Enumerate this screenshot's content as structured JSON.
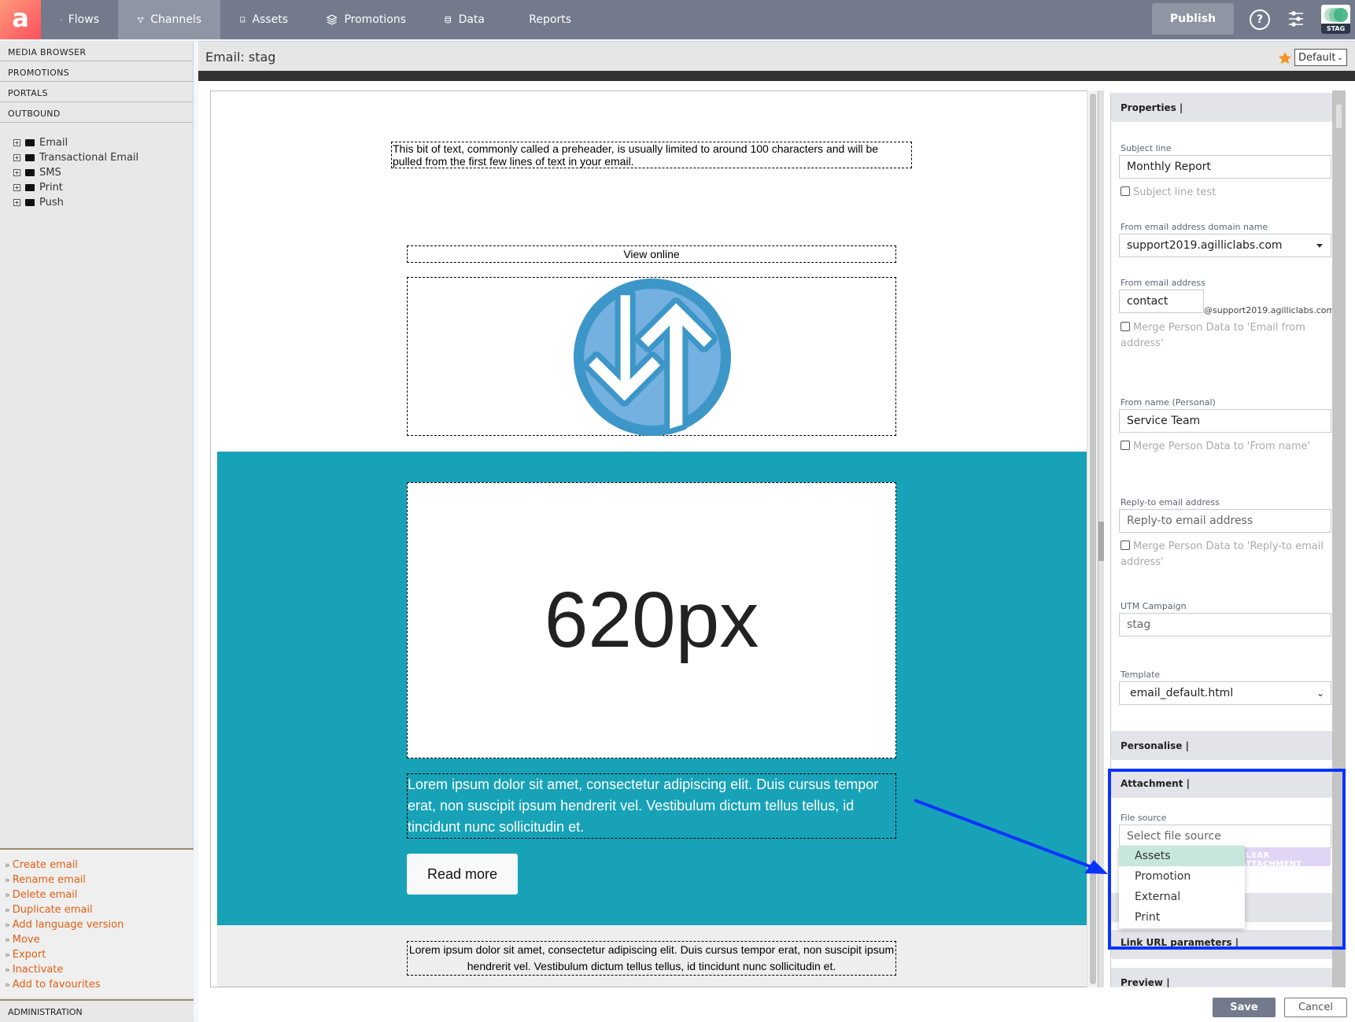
{
  "app": {
    "logo_letter": "a",
    "nav": [
      {
        "label": "Flows",
        "icon": "flows-icon",
        "active": false
      },
      {
        "label": "Channels",
        "icon": "channels-icon",
        "active": true
      },
      {
        "label": "Assets",
        "icon": "assets-icon",
        "active": false
      },
      {
        "label": "Promotions",
        "icon": "promotions-icon",
        "active": false
      },
      {
        "label": "Data",
        "icon": "data-icon",
        "active": false
      },
      {
        "label": "Reports",
        "icon": "reports-icon",
        "active": false
      }
    ],
    "publish_label": "Publish",
    "help_label": "?",
    "env_badge": "STAG"
  },
  "sidebar": {
    "sections": [
      "MEDIA BROWSER",
      "PROMOTIONS",
      "PORTALS",
      "OUTBOUND"
    ],
    "tree": [
      "Email",
      "Transactional Email",
      "SMS",
      "Print",
      "Push"
    ],
    "actions": [
      "Create email",
      "Rename email",
      "Delete email",
      "Duplicate email",
      "Add language version",
      "Move",
      "Export",
      "Inactivate",
      "Add to favourites"
    ],
    "footer_section": "ADMINISTRATION"
  },
  "editor": {
    "title": "Email: stag",
    "view_select": "Default",
    "email": {
      "preheader": "This bit of text, commonly called a preheader, is usually limited to around 100 characters and will be pulled from the first few lines of text in your email.",
      "view_online": "View online",
      "hero_placeholder": "620px",
      "hero_text": "Lorem ipsum dolor sit amet, consectetur adipiscing elit. Duis cursus tempor erat, non suscipit ipsum hendrerit vel. Vestibulum dictum tellus tellus, id tincidunt nunc sollicitudin et.",
      "read_more": "Read more",
      "footer_text": "Lorem ipsum dolor sit amet, consectetur adipiscing elit. Duis cursus tempor erat, non suscipit ipsum hendrerit vel. Vestibulum dictum tellus tellus, id tincidunt nunc sollicitudin et.",
      "colors": {
        "hero_bg": "#17a2b8",
        "logo_outer": "#3d96c8",
        "logo_inner": "#74b0e0"
      }
    }
  },
  "properties": {
    "section_title": "Properties |",
    "subject_line_label": "Subject line",
    "subject_line_value": "Monthly Report",
    "subject_line_test": "Subject line test",
    "domain_label": "From email address domain name",
    "domain_value": "support2019.agilliclabs.com",
    "from_email_label": "From email address",
    "from_email_value": "contact",
    "from_email_suffix": "@support2019.agilliclabs.com",
    "merge_from_email": "Merge Person Data to 'Email from address'",
    "from_name_label": "From name (Personal)",
    "from_name_value": "Service Team",
    "merge_from_name": "Merge Person Data to 'From name'",
    "reply_to_label": "Reply-to email address",
    "reply_to_placeholder": "Reply-to email address",
    "merge_reply_to": "Merge Person Data to 'Reply-to email address'",
    "utm_label": "UTM Campaign",
    "utm_value": "stag",
    "template_label": "Template",
    "template_value": "email_default.html",
    "personalise_title": "Personalise |",
    "attachment_title": "Attachment |",
    "file_source_label": "File source",
    "file_source_placeholder": "Select file source",
    "clear_attachment": "CLEAR ATTACHMENT",
    "file_source_options": [
      "Assets",
      "Promotion",
      "External",
      "Print"
    ],
    "highlighted_option": "Assets",
    "link_url_title": "Link URL parameters |",
    "preview_title": "Preview |"
  },
  "footer": {
    "save_label": "Save",
    "cancel_label": "Cancel"
  },
  "annotation": {
    "color": "#0a33ff"
  }
}
